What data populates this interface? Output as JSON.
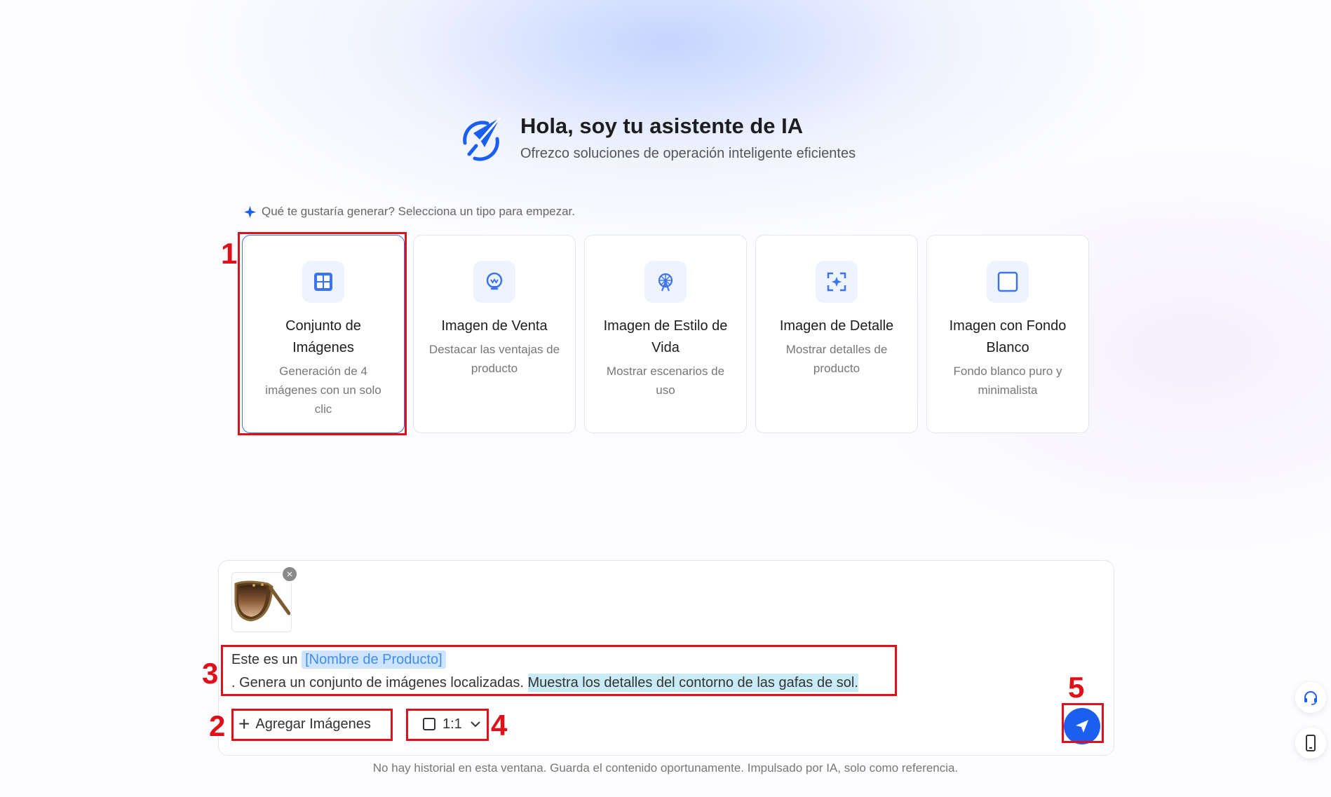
{
  "header": {
    "title": "Hola, soy tu asistente de IA",
    "subtitle": "Ofrezco soluciones de operación inteligente eficientes"
  },
  "prompt": "Qué te gustaría generar? Selecciona un tipo para empezar.",
  "cards": [
    {
      "title": "Conjunto de Imágenes",
      "desc": "Generación de 4 imágenes con un solo clic",
      "icon": "grid-icon",
      "selected": true
    },
    {
      "title": "Imagen de Venta",
      "desc": "Destacar las ventajas de producto",
      "icon": "lightbulb-icon",
      "selected": false
    },
    {
      "title": "Imagen de Estilo de Vida",
      "desc": "Mostrar escenarios de uso",
      "icon": "ferris-wheel-icon",
      "selected": false
    },
    {
      "title": "Imagen de Detalle",
      "desc": "Mostrar detalles de producto",
      "icon": "focus-icon",
      "selected": false
    },
    {
      "title": "Imagen con Fondo Blanco",
      "desc": "Fondo blanco puro y minimalista",
      "icon": "square-icon",
      "selected": false
    }
  ],
  "input": {
    "text_prefix": "Este es un",
    "chip": "[Nombre de Producto]",
    "text_middle": ". Genera un conjunto de imágenes localizadas.",
    "text_highlight": "Muestra los detalles del contorno de las gafas de sol.",
    "remove_symbol": "×"
  },
  "toolbar": {
    "add_images_label": "Agregar Imágenes",
    "ratio_label": "1:1"
  },
  "footer": "No hay historial en esta ventana. Guarda el contenido oportunamente. Impulsado por IA, solo como referencia.",
  "annotations": [
    "1",
    "2",
    "3",
    "4",
    "5"
  ],
  "colors": {
    "accent": "#1a5ff0",
    "annotation": "#e0101a",
    "chip_bg": "#cfe5ff",
    "highlight_bg": "#c9ebf6"
  }
}
